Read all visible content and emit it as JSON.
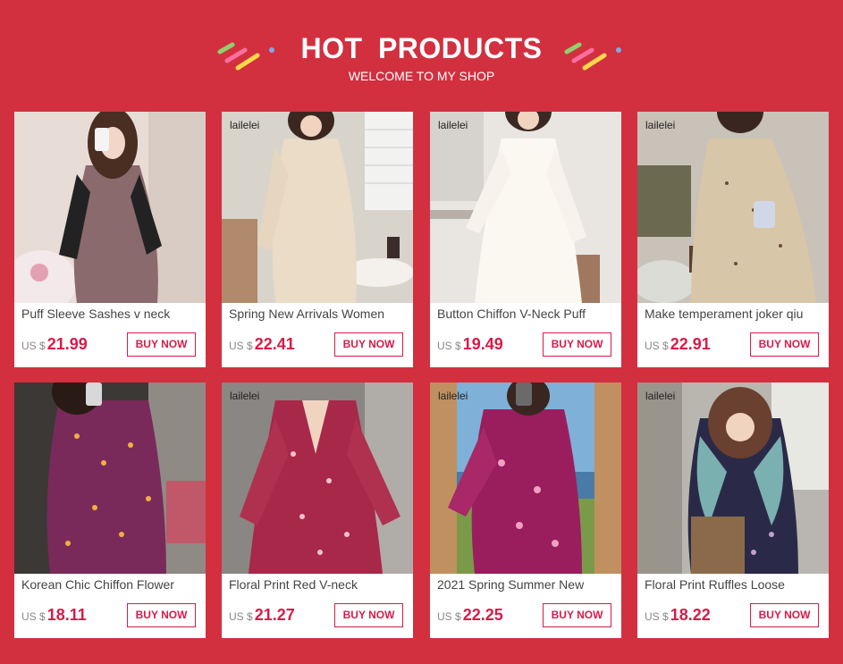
{
  "header": {
    "title": "HOT  PRODUCTS",
    "subtitle": "WELCOME TO MY SHOP"
  },
  "currency_label": "US $",
  "products": [
    {
      "name": "Puff Sleeve Sashes v neck",
      "price": "21.99",
      "button": "BUY NOW",
      "brand": "",
      "image": "woman-brown-dress-black-sleeves"
    },
    {
      "name": "Spring New Arrivals Women",
      "price": "22.41",
      "button": "BUY NOW",
      "brand": "lailelei",
      "image": "woman-beige-lace-dress"
    },
    {
      "name": "Button Chiffon V-Neck Puff",
      "price": "19.49",
      "button": "BUY NOW",
      "brand": "lailelei",
      "image": "woman-white-chiffon-dress"
    },
    {
      "name": "Make temperament joker qiu",
      "price": "22.91",
      "button": "BUY NOW",
      "brand": "lailelei",
      "image": "woman-floral-beige-dress"
    },
    {
      "name": "Korean Chic Chiffon Flower",
      "price": "18.11",
      "button": "BUY NOW",
      "brand": "",
      "image": "woman-purple-floral-dress"
    },
    {
      "name": "Floral Print Red V-neck",
      "price": "21.27",
      "button": "BUY NOW",
      "brand": "lailelei",
      "image": "woman-red-floral-dress"
    },
    {
      "name": "2021 Spring Summer New",
      "price": "22.25",
      "button": "BUY NOW",
      "brand": "lailelei",
      "image": "woman-magenta-floral-dress-outdoor"
    },
    {
      "name": "Floral Print Ruffles Loose",
      "price": "18.22",
      "button": "BUY NOW",
      "brand": "lailelei",
      "image": "woman-navy-floral-dress-cardigan"
    }
  ],
  "colors": {
    "background": "#d2303f",
    "accent": "#d81b48",
    "card": "#ffffff"
  }
}
